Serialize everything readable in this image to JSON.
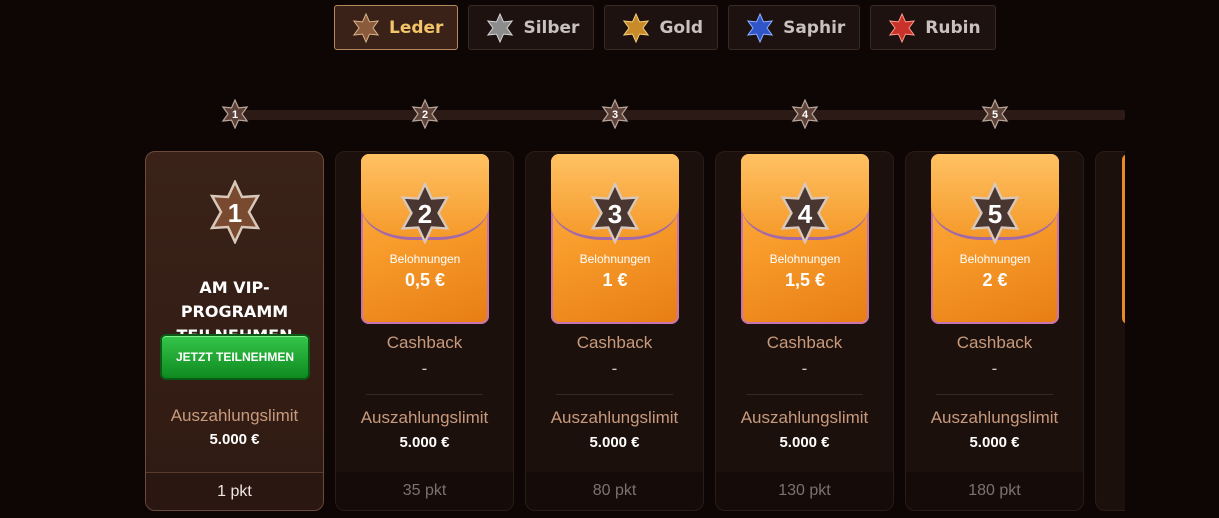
{
  "tabs": [
    {
      "label": "Leder",
      "color": "#8a5a3c",
      "active": true
    },
    {
      "label": "Silber",
      "color": "#8c8c8c",
      "active": false
    },
    {
      "label": "Gold",
      "color": "#c98a2a",
      "active": false
    },
    {
      "label": "Saphir",
      "color": "#2f55c8",
      "active": false
    },
    {
      "label": "Rubin",
      "color": "#c8322a",
      "active": false
    }
  ],
  "levels": [
    "1",
    "2",
    "3",
    "4",
    "5"
  ],
  "join_card": {
    "level": "1",
    "title_line1": "AM VIP-PROGRAMM",
    "title_line2": "TEILNEHMEN",
    "button": "JETZT TEILNEHMEN",
    "limit_label": "Auszahlungslimit",
    "limit_value": "5.000 €",
    "points": "1 pkt"
  },
  "level_cards": [
    {
      "level": "2",
      "reward_label": "Belohnungen",
      "reward_value": "0,5 €",
      "cashback_label": "Cashback",
      "cashback_value": "-",
      "limit_label": "Auszahlungslimit",
      "limit_value": "5.000 €",
      "points": "35 pkt"
    },
    {
      "level": "3",
      "reward_label": "Belohnungen",
      "reward_value": "1 €",
      "cashback_label": "Cashback",
      "cashback_value": "-",
      "limit_label": "Auszahlungslimit",
      "limit_value": "5.000 €",
      "points": "80 pkt"
    },
    {
      "level": "4",
      "reward_label": "Belohnungen",
      "reward_value": "1,5 €",
      "cashback_label": "Cashback",
      "cashback_value": "-",
      "limit_label": "Auszahlungslimit",
      "limit_value": "5.000 €",
      "points": "130 pkt"
    },
    {
      "level": "5",
      "reward_label": "Belohnungen",
      "reward_value": "2 €",
      "cashback_label": "Cashback",
      "cashback_value": "-",
      "limit_label": "Auszahlungslimit",
      "limit_value": "5.000 €",
      "points": "180 pkt"
    }
  ],
  "icons": {
    "tier": "star-badge-icon",
    "level": "star-badge-icon",
    "reward": "envelope-icon"
  }
}
